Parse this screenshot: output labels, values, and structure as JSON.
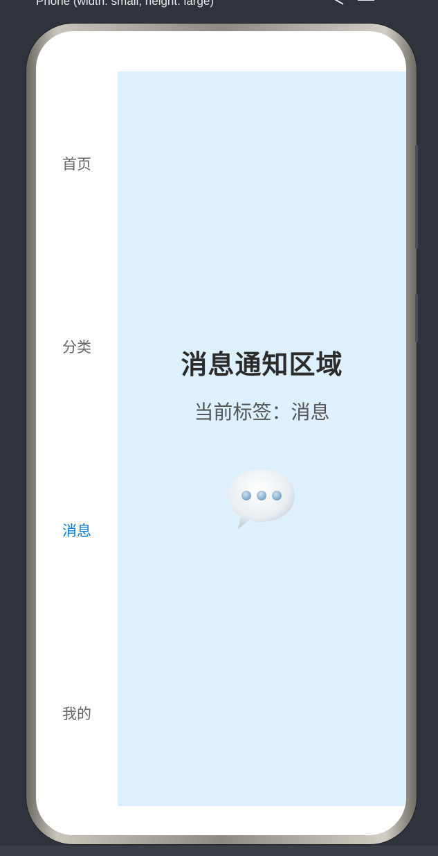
{
  "toolbar": {
    "device_label": "Phone (width: small, height: large)"
  },
  "sidebar": {
    "tabs": [
      {
        "label": "首页",
        "active": false
      },
      {
        "label": "分类",
        "active": false
      },
      {
        "label": "消息",
        "active": true
      },
      {
        "label": "我的",
        "active": false
      }
    ]
  },
  "content": {
    "title": "消息通知区域",
    "subtitle": "当前标签：消息",
    "icon": "speech-bubble-icon"
  },
  "colors": {
    "active_tab": "#0a7ee0",
    "inactive_tab": "#666666",
    "content_bg": "#ddf0fc",
    "editor_bg": "#2f343c"
  }
}
